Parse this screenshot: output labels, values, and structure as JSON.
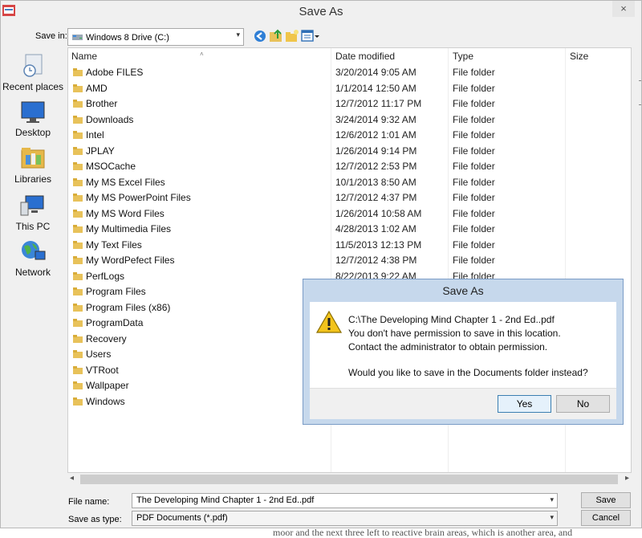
{
  "window": {
    "title": "Save As",
    "close_glyph": "×"
  },
  "save_in": {
    "label": "Save in:",
    "value": "Windows 8 Drive (C:)",
    "arrow": "▾"
  },
  "toolbar": {
    "icons": [
      "back-icon",
      "up-folder-icon",
      "new-folder-icon",
      "view-menu-icon"
    ]
  },
  "places": [
    {
      "label": "Recent places",
      "icon": "recent-places-icon"
    },
    {
      "label": "Desktop",
      "icon": "desktop-icon"
    },
    {
      "label": "Libraries",
      "icon": "libraries-icon"
    },
    {
      "label": "This PC",
      "icon": "this-pc-icon"
    },
    {
      "label": "Network",
      "icon": "network-icon"
    }
  ],
  "columns": {
    "name": "Name",
    "date": "Date modified",
    "type": "Type",
    "size": "Size",
    "sort_glyph": "˄"
  },
  "files": [
    {
      "name": "Adobe FILES",
      "date": "3/20/2014 9:05 AM",
      "type": "File folder"
    },
    {
      "name": "AMD",
      "date": "1/1/2014 12:50 AM",
      "type": "File folder"
    },
    {
      "name": "Brother",
      "date": "12/7/2012 11:17 PM",
      "type": "File folder"
    },
    {
      "name": "Downloads",
      "date": "3/24/2014 9:32 AM",
      "type": "File folder"
    },
    {
      "name": "Intel",
      "date": "12/6/2012 1:01 AM",
      "type": "File folder"
    },
    {
      "name": "JPLAY",
      "date": "1/26/2014 9:14 PM",
      "type": "File folder"
    },
    {
      "name": "MSOCache",
      "date": "12/7/2012 2:53 PM",
      "type": "File folder"
    },
    {
      "name": "My MS Excel Files",
      "date": "10/1/2013 8:50 AM",
      "type": "File folder"
    },
    {
      "name": "My MS PowerPoint Files",
      "date": "12/7/2012 4:37 PM",
      "type": "File folder"
    },
    {
      "name": "My MS Word Files",
      "date": "1/26/2014 10:58 AM",
      "type": "File folder"
    },
    {
      "name": "My Multimedia Files",
      "date": "4/28/2013 1:02 AM",
      "type": "File folder"
    },
    {
      "name": "My Text Files",
      "date": "11/5/2013 12:13 PM",
      "type": "File folder"
    },
    {
      "name": "My WordPefect Files",
      "date": "12/7/2012 4:38 PM",
      "type": "File folder"
    },
    {
      "name": "PerfLogs",
      "date": "8/22/2013 9:22 AM",
      "type": "File folder"
    },
    {
      "name": "Program Files",
      "date": "",
      "type": ""
    },
    {
      "name": "Program Files (x86)",
      "date": "",
      "type": ""
    },
    {
      "name": "ProgramData",
      "date": "",
      "type": ""
    },
    {
      "name": "Recovery",
      "date": "",
      "type": ""
    },
    {
      "name": "Users",
      "date": "",
      "type": ""
    },
    {
      "name": "VTRoot",
      "date": "",
      "type": ""
    },
    {
      "name": "Wallpaper",
      "date": "",
      "type": ""
    },
    {
      "name": "Windows",
      "date": "",
      "type": ""
    }
  ],
  "scrollbar": {
    "left_glyph": "◂",
    "right_glyph": "▸"
  },
  "file_name": {
    "label": "File name:",
    "value": "The Developing Mind Chapter 1 - 2nd Ed..pdf",
    "arrow": "▾"
  },
  "save_type": {
    "label": "Save as type:",
    "value": "PDF Documents (*.pdf)",
    "arrow": "▾"
  },
  "buttons": {
    "save": "Save",
    "cancel": "Cancel"
  },
  "dialog": {
    "title": "Save As",
    "lines": [
      "C:\\The Developing Mind Chapter 1 - 2nd Ed..pdf",
      "You don't have permission to save in this location.",
      "Contact the administrator to obtain permission.",
      "Would you like to save in the Documents folder instead?"
    ],
    "yes": "Yes",
    "no": "No",
    "icon": "warning-icon"
  },
  "background_text": "moor and the next three left to reactive brain areas, which is another area, and"
}
